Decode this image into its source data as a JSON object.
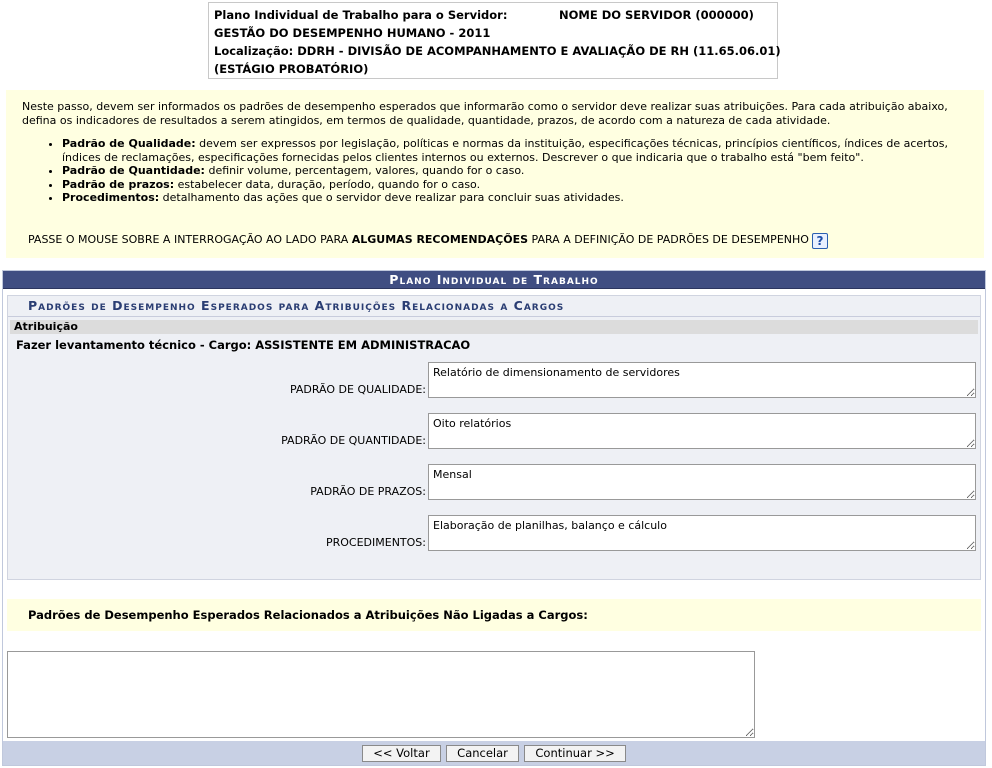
{
  "header": {
    "line1_label": "Plano Individual de Trabalho para o Servidor:",
    "server_name": "NOME DO SERVIDOR (000000)",
    "line2": "GESTÃO DO DESEMPENHO HUMANO - 2011",
    "line3": "Localização: DDRH - DIVISÃO DE ACOMPANHAMENTO E AVALIAÇÃO DE RH (11.65.06.01)",
    "line4": "(ESTÁGIO PROBATÓRIO)"
  },
  "instructions": {
    "intro": "Neste passo, devem ser informados os padrões de desempenho esperados que informarão como o servidor deve realizar suas atribuições. Para cada atribuição abaixo, defina os indicadores de resultados a serem atingidos, em termos de qualidade, quantidade, prazos, de acordo com a natureza de cada atividade.",
    "items": [
      {
        "term": "Padrão de Qualidade:",
        "text": " devem ser expressos por legislação, políticas e normas da instituição, especificações técnicas, princípios científicos, índices de acertos, índices de reclamações, especificações fornecidas pelos clientes internos ou externos. Descrever o que indicaria que o trabalho está \"bem feito\"."
      },
      {
        "term": "Padrão de Quantidade:",
        "text": " definir volume, percentagem, valores, quando for o caso."
      },
      {
        "term": "Padrão de prazos:",
        "text": " estabelecer data, duração, período, quando for o caso."
      },
      {
        "term": "Procedimentos:",
        "text": " detalhamento das ações que o servidor deve realizar para concluir suas atividades."
      }
    ],
    "note_prefix": "PASSE O MOUSE SOBRE A INTERROGAÇÃO AO LADO PARA ",
    "note_bold": "ALGUMAS RECOMENDAÇÕES",
    "note_suffix": " PARA A DEFINIÇÃO DE PADRÕES DE DESEMPENHO",
    "help_glyph": "?"
  },
  "form": {
    "title": "Plano Individual de Trabalho",
    "section_title": "Padrões de Desempenho Esperados para Atribuições Relacionadas a Cargos",
    "attribution_header": "Atribuição",
    "attribution_desc": "Fazer levantamento técnico - Cargo: ASSISTENTE EM ADMINISTRACAO",
    "fields": [
      {
        "label": "PADRÃO DE QUALIDADE:",
        "value": "Relatório de dimensionamento de servidores"
      },
      {
        "label": "PADRÃO DE QUANTIDADE:",
        "value": "Oito relatórios"
      },
      {
        "label": "PADRÃO DE PRAZOS:",
        "value": "Mensal"
      },
      {
        "label": "PROCEDIMENTOS:",
        "value": "Elaboração de planilhas, balanço e cálculo"
      }
    ],
    "nonlinked_title": "Padrões de Desempenho Esperados Relacionados a Atribuições Não Ligadas a Cargos:",
    "nonlinked_value": ""
  },
  "buttons": {
    "back": "<< Voltar",
    "cancel": "Cancelar",
    "continue": "Continuar >>"
  }
}
